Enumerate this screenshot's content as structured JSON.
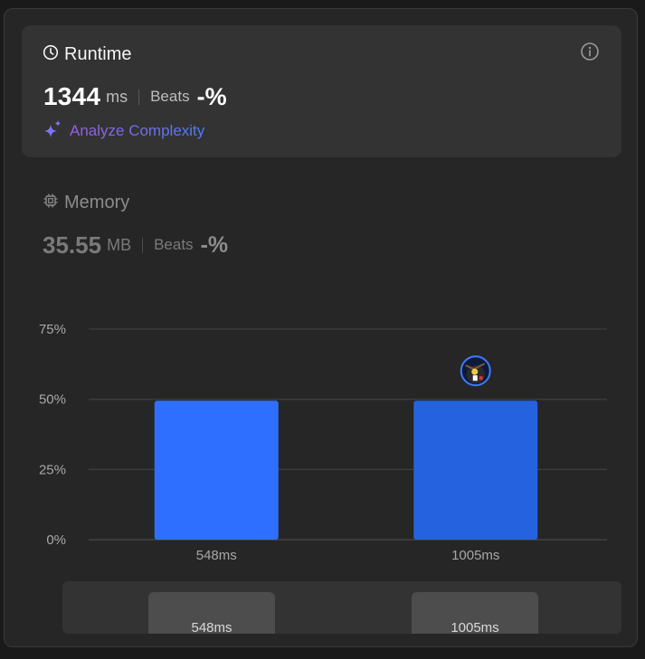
{
  "runtime": {
    "title": "Runtime",
    "value": "1344",
    "unit": "ms",
    "beats_label": "Beats",
    "beats_value": "-%",
    "analyze_label": "Analyze Complexity",
    "icon": "clock-icon",
    "info_icon": "info-icon"
  },
  "memory": {
    "title": "Memory",
    "value": "35.55",
    "unit": "MB",
    "beats_label": "Beats",
    "beats_value": "-%",
    "icon": "chip-icon"
  },
  "colors": {
    "bar": "#2f6fff",
    "bar_current": "#2462e0",
    "accent_purple": "#9b5de5",
    "accent_blue": "#4a7dff"
  },
  "chart_data": {
    "type": "bar",
    "categories": [
      "548ms",
      "1005ms"
    ],
    "values": [
      49.5,
      49.5
    ],
    "ylim": [
      0,
      75
    ],
    "y_ticks": [
      0,
      25,
      50,
      75
    ],
    "y_tick_labels": [
      "0%",
      "25%",
      "50%",
      "75%"
    ],
    "grid": true,
    "current_marker_category": "1005ms"
  },
  "distribution_scroller": {
    "items": [
      "548ms",
      "1005ms"
    ]
  }
}
